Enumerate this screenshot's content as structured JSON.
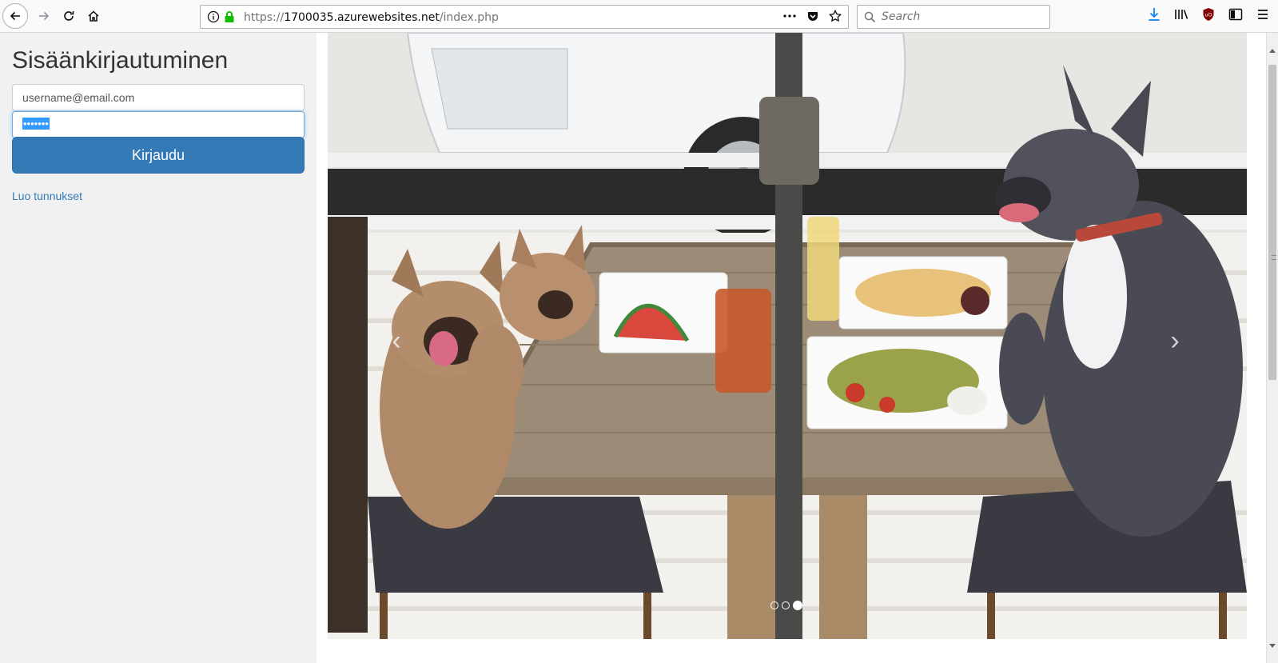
{
  "browser": {
    "url": {
      "scheme": "https://",
      "host": "1700035.azurewebsites.net",
      "path": "/index.php"
    },
    "search_placeholder": "Search",
    "icons": [
      "back-icon",
      "forward-icon",
      "reload-icon",
      "home-icon",
      "info-icon",
      "lock-icon",
      "page-actions-icon",
      "pocket-icon",
      "bookmark-star-icon",
      "search-icon",
      "downloads-icon",
      "library-icon",
      "ublock-icon",
      "sidebar-icon",
      "menu-icon"
    ],
    "colors": {
      "lock": "#12bc00",
      "downloads": "#0a84ff",
      "ublock": "#800000"
    }
  },
  "login": {
    "title": "Sisäänkirjautuminen",
    "username_value": "username@email.com",
    "password_masked": "•••••••",
    "submit_label": "Kirjaudu",
    "register_link": "Luo tunnukset"
  },
  "carousel": {
    "prev_glyph": "‹",
    "next_glyph": "›",
    "slide_count": 3,
    "active_index": 2
  },
  "colors": {
    "primary": "#337ab7",
    "link": "#337ab7",
    "sidebar_bg": "#f1f1f1"
  }
}
